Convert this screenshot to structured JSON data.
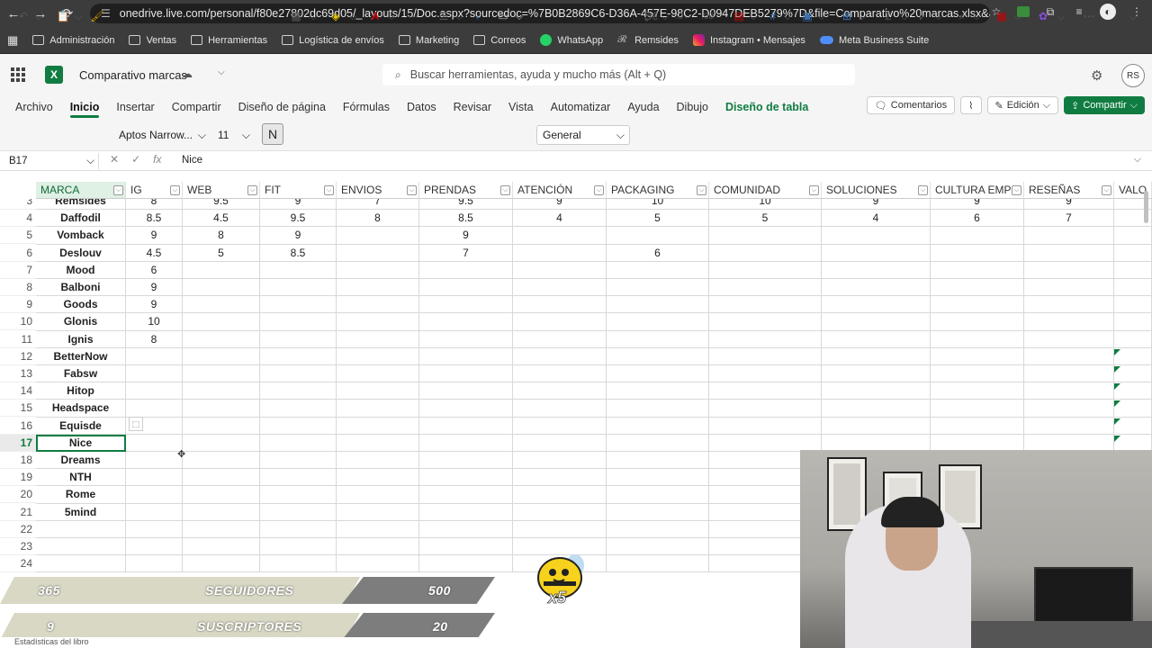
{
  "browser": {
    "url": "onedrive.live.com/personal/f80e27802dc69d05/_layouts/15/Doc.aspx?sourcedoc=%7B0B2869C6-D36A-457E-98C2-D0947DEB5279%7D&file=Comparativo%20marcas.xlsx&action=...",
    "bookmarks": [
      "Administración",
      "Ventas",
      "Herramientas",
      "Logística de envíos",
      "Marketing",
      "Correos",
      "WhatsApp",
      "Remsides",
      "Instagram • Mensajes",
      "Meta Business Suite"
    ]
  },
  "app": {
    "doc_name": "Comparativo marcas",
    "search_placeholder": "Buscar herramientas, ayuda y mucho más (Alt + Q)",
    "avatar": "RS"
  },
  "ribbon": {
    "tabs": [
      "Archivo",
      "Inicio",
      "Insertar",
      "Compartir",
      "Diseño de página",
      "Fórmulas",
      "Datos",
      "Revisar",
      "Vista",
      "Automatizar",
      "Ayuda",
      "Dibujo",
      "Diseño de tabla"
    ],
    "active_tab": "Inicio",
    "comments_label": "Comentarios",
    "edit_label": "Edición",
    "share_label": "Compartir",
    "font_name": "Aptos Narrow...",
    "font_size": "11",
    "bold_label": "N",
    "number_format": "General"
  },
  "formula_bar": {
    "cell_ref": "B17",
    "fx": "fx",
    "content": "Nice"
  },
  "sheet": {
    "headers": [
      "MARCA",
      "IG",
      "WEB",
      "FIT",
      "ENVIOS",
      "PRENDAS",
      "ATENCIÓN",
      "PACKAGING",
      "COMUNIDAD",
      "SOLUCIONES",
      "CULTURA EMPR",
      "RESEÑAS",
      "VALO"
    ],
    "row_numbers": [
      "3",
      "4",
      "5",
      "6",
      "7",
      "8",
      "9",
      "10",
      "11",
      "12",
      "13",
      "14",
      "15",
      "16",
      "17",
      "18",
      "19",
      "20",
      "21",
      "22",
      "23",
      "24"
    ],
    "selected_row": "17",
    "rows": [
      [
        "Remsides",
        "8",
        "9.5",
        "9",
        "7",
        "9.5",
        "9",
        "10",
        "10",
        "9",
        "9",
        "9"
      ],
      [
        "Daffodil",
        "8.5",
        "4.5",
        "9.5",
        "8",
        "8.5",
        "4",
        "5",
        "5",
        "4",
        "6",
        "7"
      ],
      [
        "Vomback",
        "9",
        "8",
        "9",
        "",
        "9",
        "",
        "",
        "",
        "",
        "",
        ""
      ],
      [
        "Deslouv",
        "4.5",
        "5",
        "8.5",
        "",
        "7",
        "",
        "6",
        "",
        "",
        "",
        ""
      ],
      [
        "Mood",
        "6",
        "",
        "",
        "",
        "",
        "",
        "",
        "",
        "",
        "",
        ""
      ],
      [
        "Balboni",
        "9",
        "",
        "",
        "",
        "",
        "",
        "",
        "",
        "",
        "",
        ""
      ],
      [
        "Goods",
        "9",
        "",
        "",
        "",
        "",
        "",
        "",
        "",
        "",
        "",
        ""
      ],
      [
        "Glonis",
        "10",
        "",
        "",
        "",
        "",
        "",
        "",
        "",
        "",
        "",
        ""
      ],
      [
        "Ignis",
        "8",
        "",
        "",
        "",
        "",
        "",
        "",
        "",
        "",
        "",
        ""
      ],
      [
        "BetterNow",
        "",
        "",
        "",
        "",
        "",
        "",
        "",
        "",
        "",
        "",
        ""
      ],
      [
        "Fabsw",
        "",
        "",
        "",
        "",
        "",
        "",
        "",
        "",
        "",
        "",
        ""
      ],
      [
        "Hitop",
        "",
        "",
        "",
        "",
        "",
        "",
        "",
        "",
        "",
        "",
        ""
      ],
      [
        "Headspace",
        "",
        "",
        "",
        "",
        "",
        "",
        "",
        "",
        "",
        "",
        ""
      ],
      [
        "Equisde",
        "",
        "",
        "",
        "",
        "",
        "",
        "",
        "",
        "",
        "",
        ""
      ],
      [
        "Nice",
        "",
        "",
        "",
        "",
        "",
        "",
        "",
        "",
        "",
        "",
        ""
      ],
      [
        "Dreams",
        "",
        "",
        "",
        "",
        "",
        "",
        "",
        "",
        "",
        "",
        ""
      ],
      [
        "NTH",
        "",
        "",
        "",
        "",
        "",
        "",
        "",
        "",
        "",
        "",
        ""
      ],
      [
        "Rome",
        "",
        "",
        "",
        "",
        "",
        "",
        "",
        "",
        "",
        "",
        ""
      ],
      [
        "5mind",
        "",
        "",
        "",
        "",
        "",
        "",
        "",
        "",
        "",
        "",
        ""
      ],
      [
        "",
        "",
        "",
        "",
        "",
        "",
        "",
        "",
        "",
        "",
        "",
        ""
      ],
      [
        "",
        "",
        "",
        "",
        "",
        "",
        "",
        "",
        "",
        "",
        "",
        ""
      ],
      [
        "",
        "",
        "",
        "",
        "",
        "",
        "",
        "",
        "",
        "",
        "",
        ""
      ]
    ]
  },
  "overlay": {
    "row1": {
      "left": "365",
      "label": "SEGUIDORES",
      "right": "500"
    },
    "row2": {
      "left": "9",
      "label": "SUSCRIPTORES",
      "right": "20"
    },
    "multiplier": "x5"
  },
  "status": {
    "text": "Estadísticas del libro"
  },
  "colors": {
    "excel_green": "#107c41",
    "chrome_dark": "#3c3c3c"
  }
}
